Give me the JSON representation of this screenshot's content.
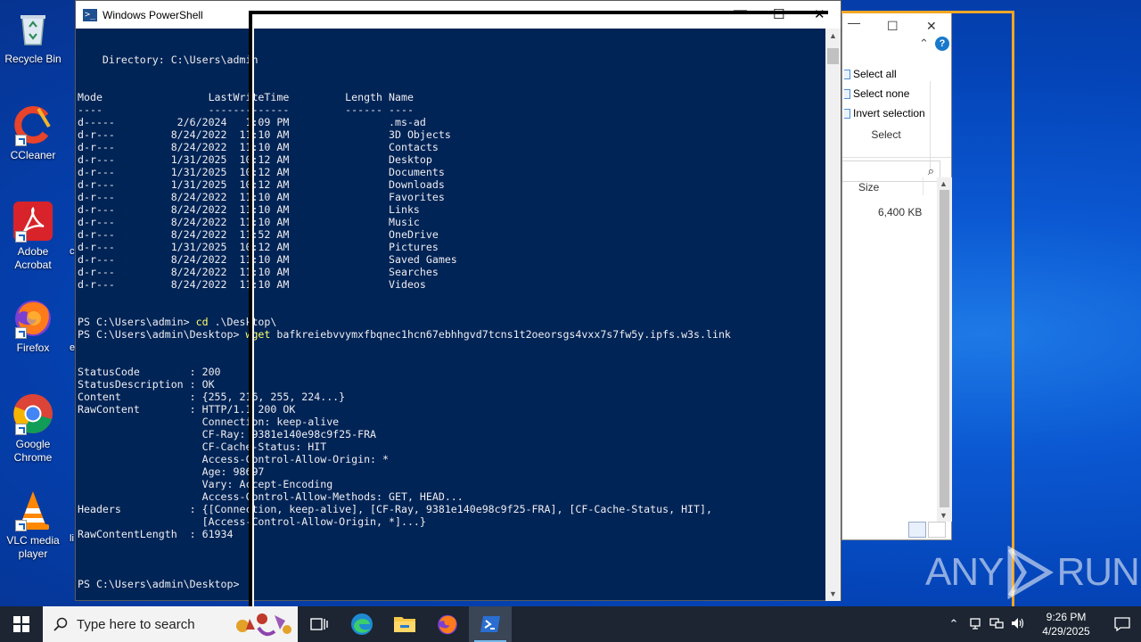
{
  "desktop": {
    "icons": [
      {
        "label": "Recycle Bin",
        "icon": "recycle-bin-icon"
      },
      {
        "label": "CCleaner",
        "icon": "ccleaner-icon"
      },
      {
        "label": "Adobe Acrobat",
        "icon": "adobe-acrobat-icon"
      },
      {
        "label": "Firefox",
        "icon": "firefox-icon"
      },
      {
        "label": "Google Chrome",
        "icon": "chrome-icon"
      },
      {
        "label": "VLC media player",
        "icon": "vlc-icon"
      }
    ],
    "stray_letters": [
      "c",
      "e",
      "li"
    ]
  },
  "powershell": {
    "title": "Windows PowerShell",
    "lines": [
      "",
      "",
      "    Directory: C:\\Users\\admin",
      "",
      "",
      "Mode                 LastWriteTime         Length Name",
      "----                 -------------         ------ ----",
      "d-----          2/6/2024   1:09 PM                .ms-ad",
      "d-r---         8/24/2022  11:10 AM                3D Objects",
      "d-r---         8/24/2022  11:10 AM                Contacts",
      "d-r---         1/31/2025  10:12 AM                Desktop",
      "d-r---         1/31/2025  10:12 AM                Documents",
      "d-r---         1/31/2025  10:12 AM                Downloads",
      "d-r---         8/24/2022  11:10 AM                Favorites",
      "d-r---         8/24/2022  11:10 AM                Links",
      "d-r---         8/24/2022  11:10 AM                Music",
      "d-r---         8/24/2022  11:52 AM                OneDrive",
      "d-r---         1/31/2025  10:12 AM                Pictures",
      "d-r---         8/24/2022  11:10 AM                Saved Games",
      "d-r---         8/24/2022  11:10 AM                Searches",
      "d-r---         8/24/2022  11:10 AM                Videos",
      "",
      "",
      "PS C:\\Users\\admin> cd .\\Desktop\\",
      "PS C:\\Users\\admin\\Desktop> wget bafkreiebvvymxfbqnec1hcn67ebhhgvd7tcns1t2oeorsgs4vxx7s7fw5y.ipfs.w3s.link",
      "",
      "",
      "StatusCode        : 200",
      "StatusDescription : OK",
      "Content           : {255, 216, 255, 224...}",
      "RawContent        : HTTP/1.1 200 OK",
      "                    Connection: keep-alive",
      "                    CF-Ray: 9381e140e98c9f25-FRA",
      "                    CF-Cache-Status: HIT",
      "                    Access-Control-Allow-Origin: *",
      "                    Age: 98697",
      "                    Vary: Accept-Encoding",
      "                    Access-Control-Allow-Methods: GET, HEAD...",
      "Headers           : {[Connection, keep-alive], [CF-Ray, 9381e140e98c9f25-FRA], [CF-Cache-Status, HIT],",
      "                    [Access-Control-Allow-Origin, *]...}",
      "RawContentLength  : 61934",
      "",
      "",
      "",
      "PS C:\\Users\\admin\\Desktop>"
    ]
  },
  "explorer": {
    "ribbon": {
      "select_all": "Select all",
      "select_none": "Select none",
      "invert_selection": "Invert selection",
      "group_label": "Select"
    },
    "column_header": "Size",
    "file_size": "6,400 KB"
  },
  "watermark": {
    "left": "ANY",
    "right": "RUN"
  },
  "taskbar": {
    "search_placeholder": "Type here to search",
    "apps": [
      "task-view-icon",
      "edge-icon",
      "file-explorer-icon",
      "firefox-icon",
      "powershell-icon"
    ],
    "time": "9:26 PM",
    "date": "4/29/2025"
  },
  "colors": {
    "console_bg": "#012456",
    "console_fg": "#eeedf0",
    "command_highlight": "#ffff66",
    "taskbar": "#1c2531",
    "frame_orange": "#f5a623"
  }
}
